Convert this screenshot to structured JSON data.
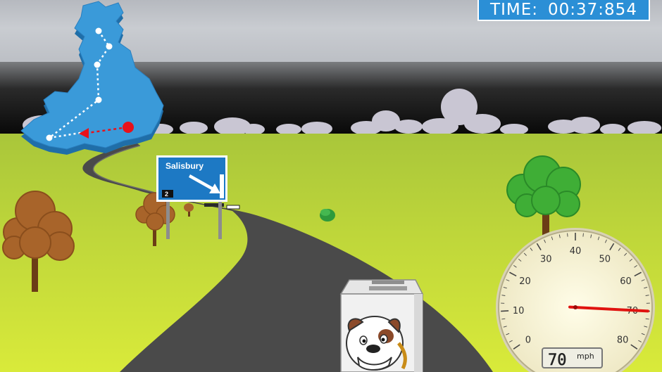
{
  "hud": {
    "timer_label": "TIME:",
    "timer_value": "00:37:854"
  },
  "road_sign": {
    "destination": "Salisbury",
    "junction_number": "2"
  },
  "speedometer": {
    "speed": 70,
    "digital_readout": "70",
    "unit": "mph",
    "scale_min": 0,
    "scale_max": 80,
    "scale_labels": [
      "0",
      "10",
      "20",
      "30",
      "40",
      "50",
      "60",
      "70",
      "80"
    ]
  },
  "minimap": {
    "route_color": "#ffffff",
    "current_segment_color": "#e8111a",
    "land_color": "#3a9ad9"
  },
  "colors": {
    "sky": "#c5c8cd",
    "storm_band": "#1a1a1a",
    "grass": "#b7d23a",
    "road": "#4a4a4a",
    "sign_blue": "#1d79c4",
    "timer_bg": "#2b8fd6"
  },
  "player_vehicle": {
    "type": "van",
    "driver": "bulldog"
  }
}
